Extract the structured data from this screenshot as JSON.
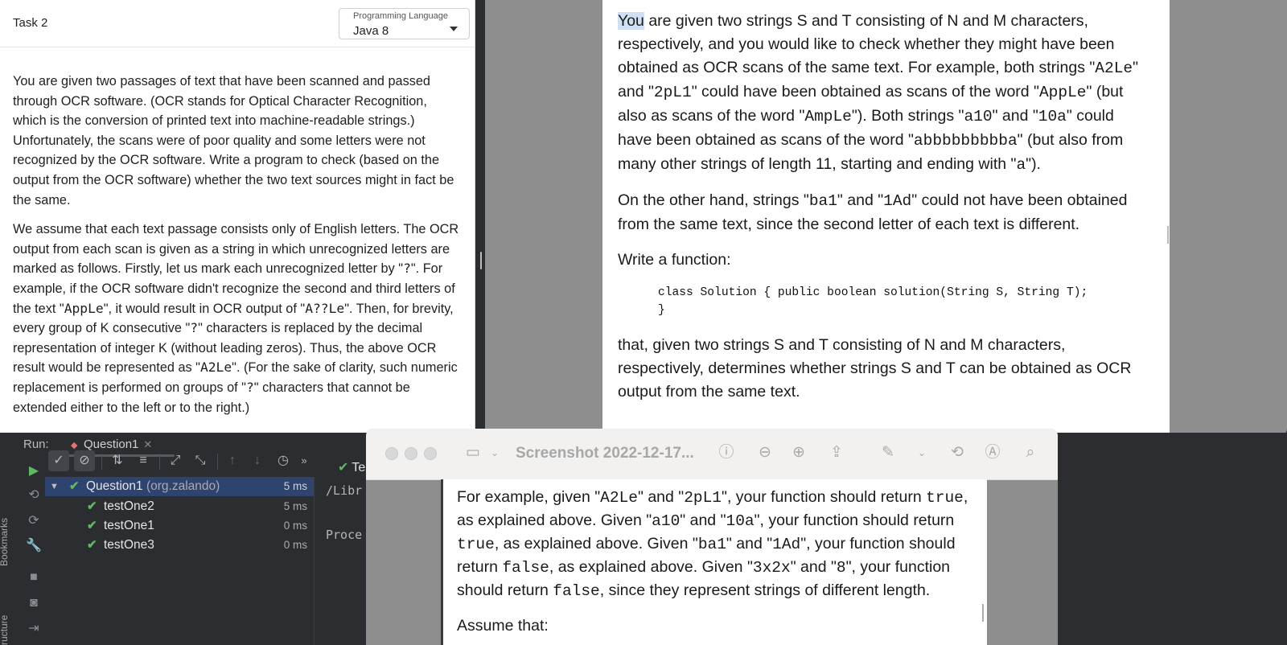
{
  "task": {
    "title": "Task 2",
    "language_caption": "Programming Language",
    "language_value": "Java 8",
    "para1": "You are given two passages of text that have been scanned and passed through OCR software. (OCR stands for Optical Character Recognition, which is the conversion of printed text into machine-readable strings.) Unfortunately, the scans were of poor quality and some letters were not recognized by the OCR software. Write a program to check (based on the output from the OCR software) whether the two text sources might in fact be the same.",
    "p2": {
      "a": "We assume that each text passage consists only of English letters. The OCR output from each scan is given as a string in which unrecognized letters are marked as follows. Firstly, let us mark each unrecognized letter by \"",
      "c1": "?",
      "b": "\". For example, if the OCR software didn't recognize the second and third letters of the text \"",
      "c2": "AppLe",
      "c": "\", it would result in OCR output of \"",
      "c3": "A??Le",
      "d": "\". Then, for brevity, every group of K consecutive \"",
      "c4": "?",
      "e": "\" characters is replaced by the decimal representation of integer K (without leading zeros). Thus, the above OCR result would be represented as \"",
      "c5": "A2Le",
      "f": "\". (For the sake of clarity, such numeric replacement is performed on groups of \"",
      "c6": "?",
      "g": "\" characters that cannot be extended either to the left or to the right.)"
    }
  },
  "doc": {
    "p1": {
      "hl": "You",
      "a": " are given two strings S and T consisting of N and M characters, respectively, and you would like to check whether they might have been obtained as OCR scans of the same text. For example, both strings \"",
      "c1": "A2Le",
      "b": "\" and \"",
      "c2": "2pL1",
      "c": "\" could have been obtained as scans of the word \"",
      "c3": "AppLe",
      "d": "\" (but also as scans of the word \"",
      "c4": "AmpLe",
      "e": "\"). Both strings \"",
      "c5": "a10",
      "f": "\" and \"",
      "c6": "10a",
      "g": "\" could have been obtained as scans of the word \"",
      "c7": "abbbbbbbbba",
      "h": "\" (but also from many other strings of length 11, starting and ending with \"",
      "c8": "a",
      "i": "\")."
    },
    "p2": {
      "a": "On the other hand, strings \"",
      "c1": "ba1",
      "b": "\" and \"",
      "c2": "1Ad",
      "c": "\" could not have been obtained from the same text, since the second letter of each text is different."
    },
    "p3": "Write a function:",
    "code_line1": "class Solution { public boolean solution(String S, String T);",
    "code_line2": "}",
    "p4": "that, given two strings S and T consisting of N and M characters, respectively, determines whether strings S and T can be obtained as OCR output from the same text."
  },
  "ide": {
    "run_label": "Run:",
    "run_tab": "Question1",
    "tests_label": "Tests",
    "bookmarks_label": "Bookmarks",
    "structure_label": "ructure",
    "tree": [
      {
        "name": "Question1",
        "pkg": " (org.zalando)",
        "time": "5 ms"
      },
      {
        "name": "testOne2",
        "time": "5 ms"
      },
      {
        "name": "testOne1",
        "time": "0 ms"
      },
      {
        "name": "testOne3",
        "time": "0 ms"
      }
    ],
    "console_path": "/Libr",
    "console_proc": "Proce"
  },
  "preview": {
    "title": "Screenshot 2022-12-17...",
    "p1": {
      "a": "For example, given \"",
      "c1": "A2Le",
      "b": "\" and \"",
      "c2": "2pL1",
      "c": "\", your function should return ",
      "c3": "true",
      "d": ", as explained above. Given \"",
      "c4": "a10",
      "e": "\" and \"",
      "c5": "10a",
      "f": "\", your function should return ",
      "c6": "true",
      "g": ", as explained above. Given \"",
      "c7": "ba1",
      "h": "\" and \"",
      "c8": "1Ad",
      "i": "\", your function should return ",
      "c9": "false",
      "j": ", as explained above. Given \"",
      "c10": "3x2x",
      "k": "\" and \"",
      "c11": "8",
      "l": "\", your function should return ",
      "c12": "false",
      "m": ", since they represent strings of different length."
    },
    "p2": "Assume that:"
  },
  "colors": {
    "ide_bg": "#2b2d30",
    "selection": "#2e436e",
    "pass_green": "#5fb865",
    "doc_highlight": "#cfe0f5"
  }
}
